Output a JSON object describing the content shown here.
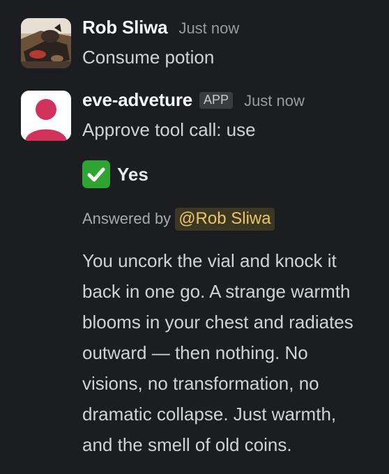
{
  "messages": [
    {
      "sender": "Rob Sliwa",
      "time": "Just now",
      "text": "Consume potion",
      "avatar": "user-photo-avatar"
    },
    {
      "sender": "eve-adveture",
      "badge": "APP",
      "time": "Just now",
      "text": "Approve tool call: use",
      "avatar": "default-user-avatar",
      "avatar_color": "#d1325a",
      "approval": {
        "icon": "check-mark-button-icon",
        "label": "Yes",
        "answered_by_label": "Answered by",
        "mention": "@Rob Sliwa"
      },
      "response_lines": [
        "You uncork the vial and knock it",
        "back in one go. A strange warmth",
        "blooms in your chest and radiates",
        "outward — then nothing. No",
        "visions, no transformation, no",
        "dramatic collapse. Just warmth,",
        "and the smell of old coins."
      ]
    }
  ],
  "colors": {
    "background": "#1b1d21",
    "check_green": "#2fa531",
    "mention_text": "#e9c46a"
  }
}
